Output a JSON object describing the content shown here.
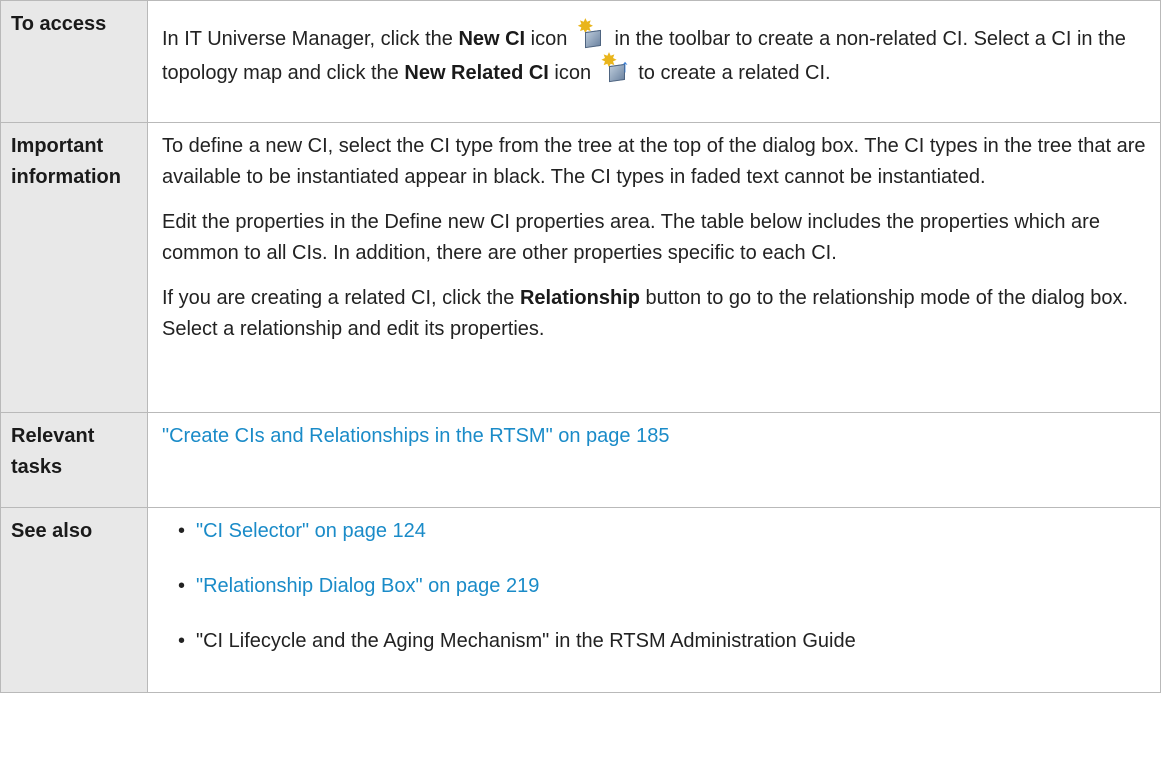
{
  "rows": {
    "access": {
      "label": "To access",
      "t1": "In IT Universe Manager, click the ",
      "b1": "New CI",
      "t2": " icon ",
      "t3": " in the toolbar to create a non-related CI. Select a CI in the topology map and click the ",
      "b2": "New Related CI",
      "t4": " icon ",
      "t5": " to create a related CI."
    },
    "important": {
      "label": "Important information",
      "p1": "To define a new CI, select the CI type from the tree at the top of the dialog box. The CI types in the tree that are available to be instantiated appear in black. The CI types in faded text cannot be instantiated.",
      "p2": "Edit the properties in the Define new CI properties area. The table below includes the properties which are common to all CIs. In addition, there are other properties specific to each CI.",
      "p3a": "If you are creating a related CI, click the ",
      "p3b": "Relationship",
      "p3c": " button to go to the relationship mode of the dialog box. Select a relationship and edit its properties."
    },
    "tasks": {
      "label": "Relevant tasks",
      "link": "\"Create CIs and Relationships in the RTSM\" on page 185"
    },
    "see_also": {
      "label": "See also",
      "items": [
        "\"CI Selector\" on page 124",
        "\"Relationship Dialog Box\" on page 219",
        "\"CI Lifecycle and the Aging Mechanism\" in the RTSM Administration Guide"
      ]
    }
  },
  "icons": {
    "new_ci": "new-ci-icon",
    "new_related_ci": "new-related-ci-icon"
  },
  "colors": {
    "link": "#1a8bc8",
    "header_bg": "#e8e8e8",
    "border": "#b9b9b9"
  }
}
